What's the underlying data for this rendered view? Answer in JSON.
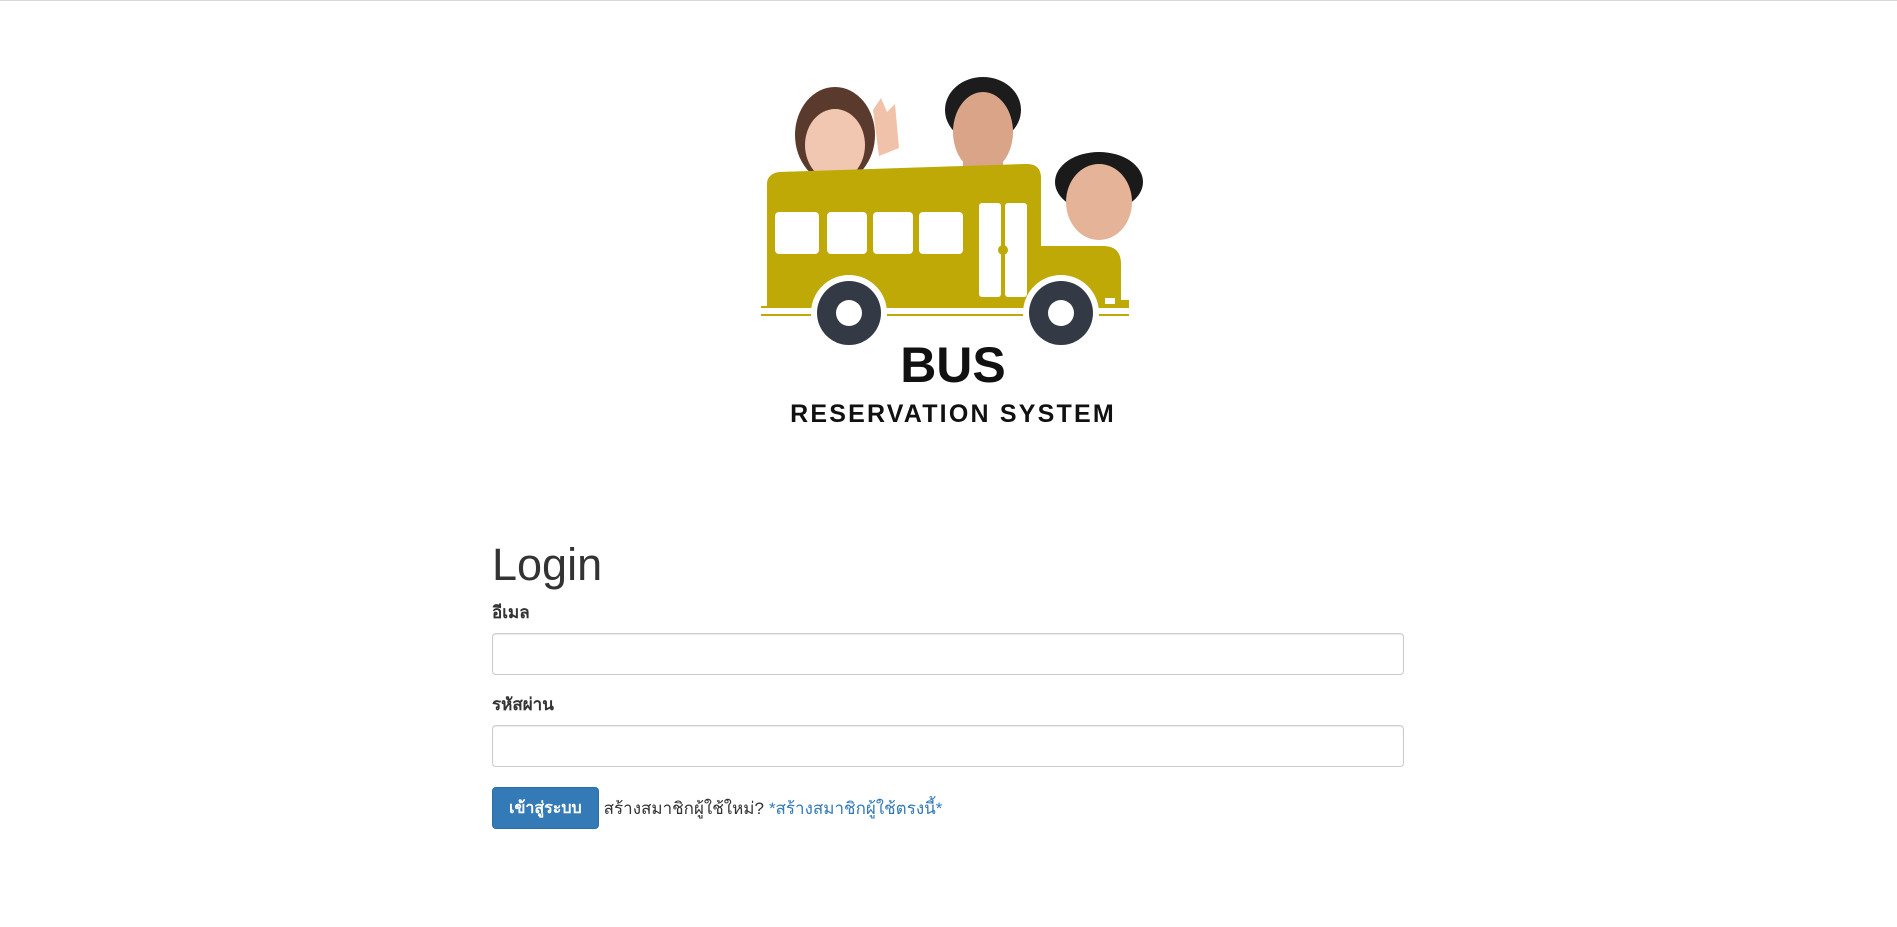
{
  "logo": {
    "title": "BUS",
    "subtitle": "RESERVATION SYSTEM",
    "colors": {
      "bus": "#bfa907",
      "wheel": "#343a45",
      "text": "#111111"
    }
  },
  "login": {
    "title": "Login",
    "email_label": "อีเมล",
    "email_value": "",
    "password_label": "รหัสผ่าน",
    "password_value": "",
    "submit_label": "เข้าสู่ระบบ",
    "register_prompt": "สร้างสมาชิกผู้ใช้ใหม่?",
    "register_link": "*สร้างสมาชิกผู้ใช้ตรงนี้*"
  },
  "colors": {
    "primary": "#337ab7",
    "text": "#333333",
    "border": "#cccccc"
  }
}
